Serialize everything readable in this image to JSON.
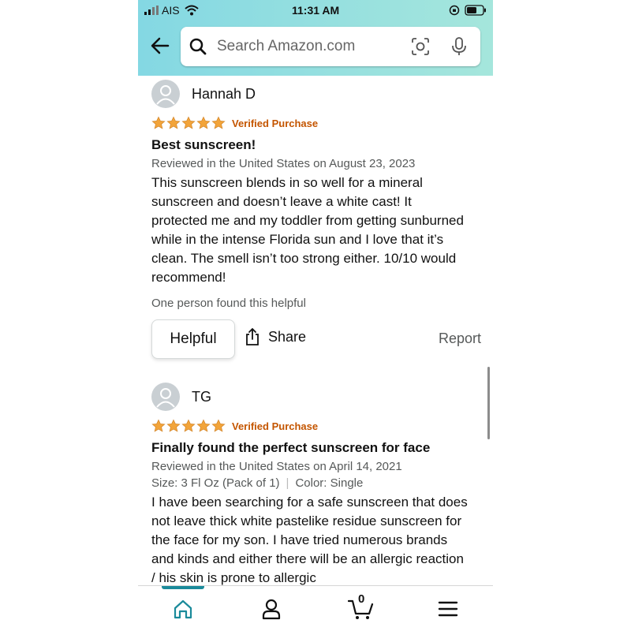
{
  "status_bar": {
    "carrier": "AIS",
    "time": "11:31 AM"
  },
  "search": {
    "placeholder": "Search Amazon.com"
  },
  "colors": {
    "header_gradient_start": "#84d8e3",
    "header_gradient_end": "#a5e6dc",
    "star": "#f2a43a",
    "verified": "#c45500",
    "nav_accent": "#1a8a9a"
  },
  "reviews": [
    {
      "reviewer": "Hannah D",
      "rating": 5,
      "verified_label": "Verified Purchase",
      "title": "Best sunscreen!",
      "date_line": "Reviewed in the United States on August 23, 2023",
      "body": "This sunscreen blends in so well for a mineral sunscreen and doesn’t leave a white cast! It protected me and my toddler from getting sunburned while in the intense Florida sun and I love that it’s clean. The smell isn’t too strong either. 10/10 would recommend!",
      "helpful_count": "One person found this helpful",
      "helpful_label": "Helpful",
      "share_label": "Share",
      "report_label": "Report"
    },
    {
      "reviewer": "TG",
      "rating": 5,
      "verified_label": "Verified Purchase",
      "title": "Finally found the perfect sunscreen for face",
      "date_line": "Reviewed in the United States on April 14, 2021",
      "size": "Size: 3 Fl Oz (Pack of 1)",
      "color": "Color: Single",
      "body": "I have been searching for a safe sunscreen that does not leave thick white pastelike residue sunscreen for the face for my son. I have tried numerous brands and kinds and either there will be an allergic reaction / his skin is prone to allergic"
    }
  ],
  "bottom_nav": {
    "items": [
      "home-icon",
      "account-icon",
      "cart-icon",
      "menu-icon"
    ],
    "cart_count": "0"
  }
}
